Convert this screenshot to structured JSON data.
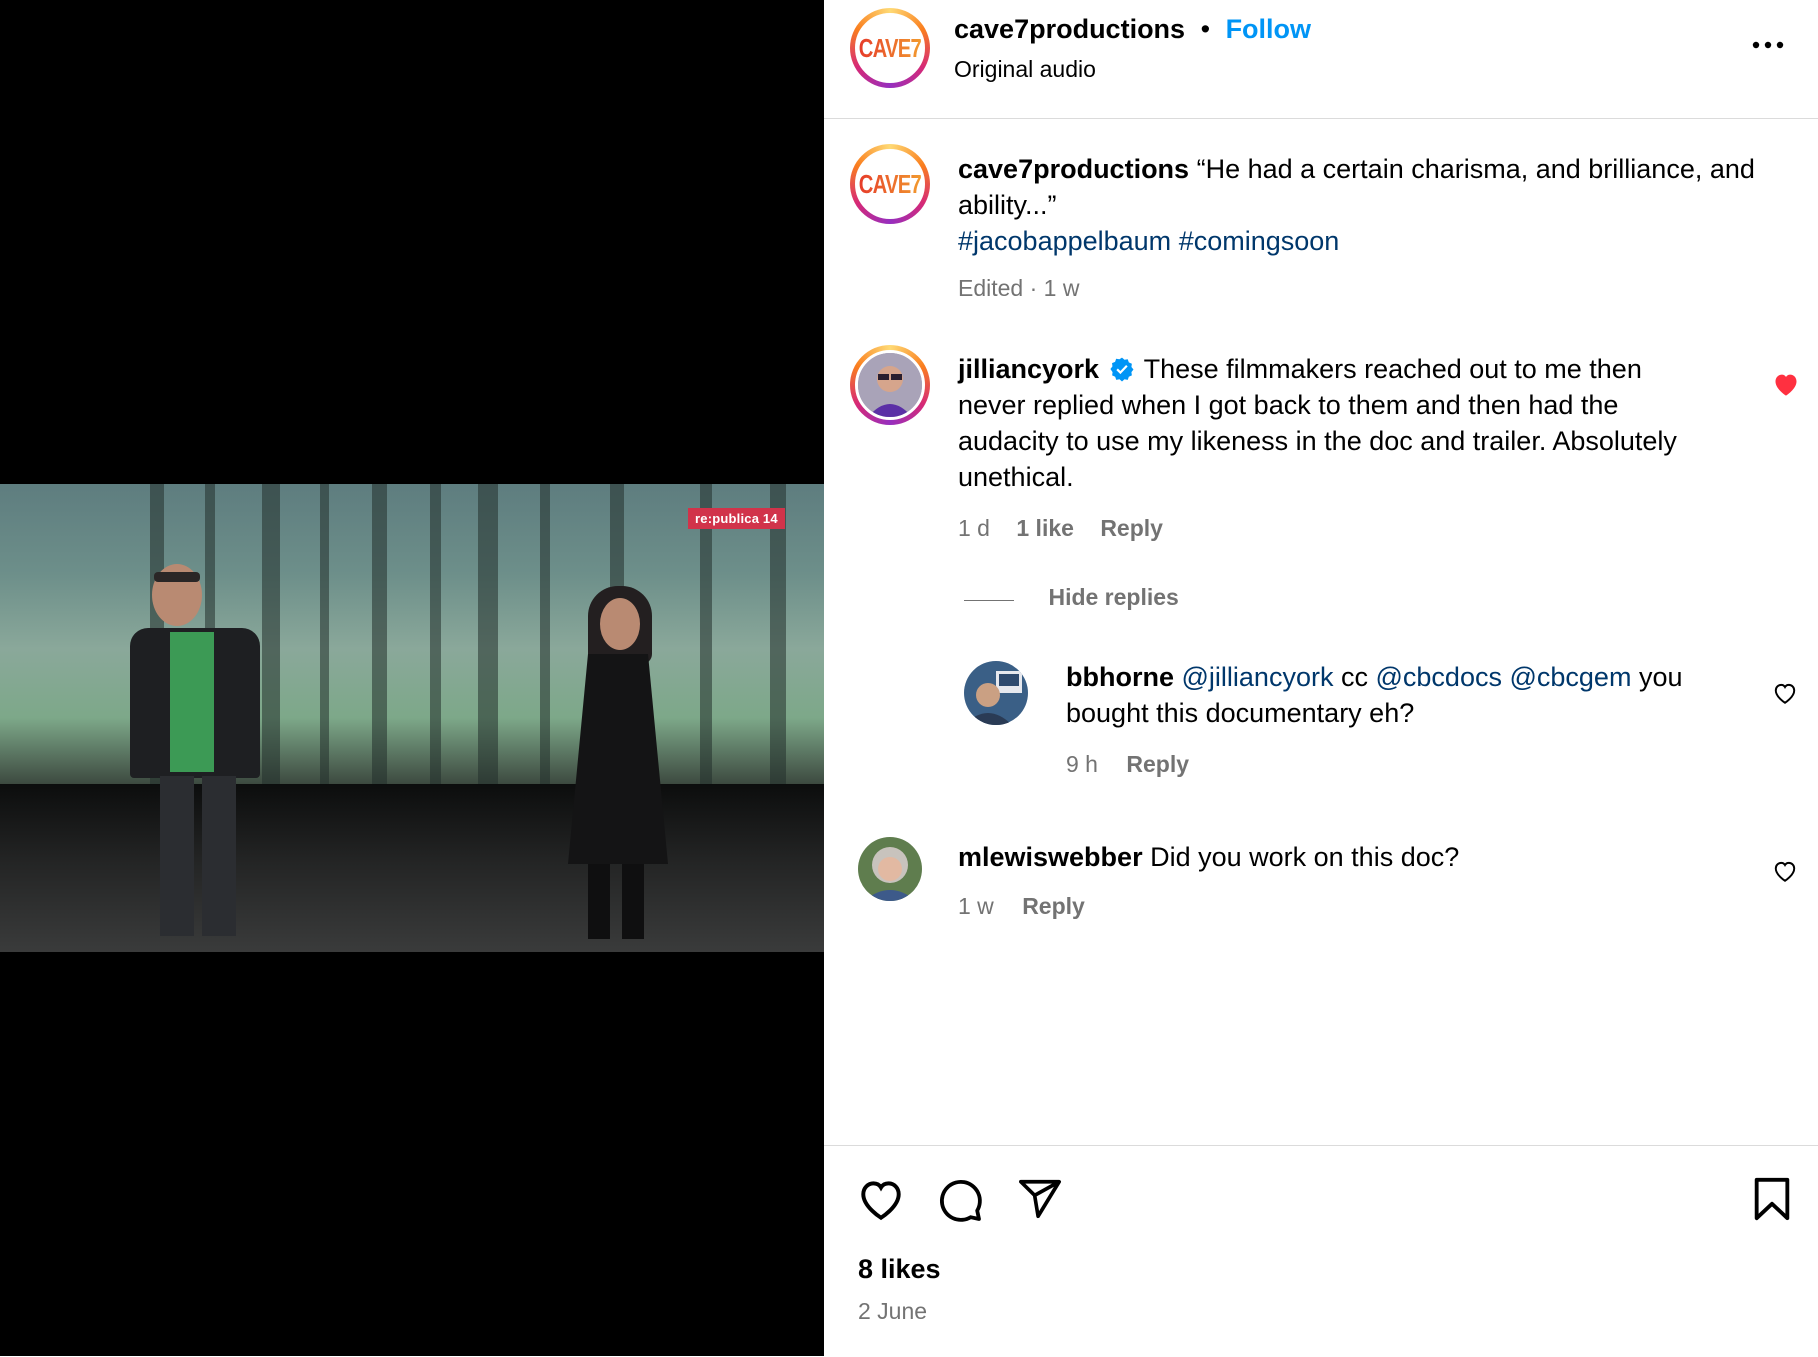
{
  "post": {
    "username": "cave7productions",
    "logo_text": "CAVE7",
    "separator": "•",
    "follow_label": "Follow",
    "audio": "Original audio"
  },
  "video": {
    "screen_logo": "re:publica 14"
  },
  "caption": {
    "username": "cave7productions",
    "text": "“He had a certain charisma, and brilliance, and ability...”",
    "hashtags": [
      "#jacobappelbaum",
      "#comingsoon"
    ],
    "meta": "Edited · 1 w"
  },
  "comments": [
    {
      "username": "jilliancyork",
      "verified": true,
      "text": "These filmmakers reached out to me then never replied when I got back to them and then had the audacity to use my likeness in the doc and trailer. Absolutely unethical.",
      "time": "1 d",
      "likes": "1 like",
      "reply_label": "Reply",
      "liked": true,
      "hide_replies_label": "Hide replies",
      "replies": [
        {
          "username": "bbhorne",
          "mention1": "@jilliancyork",
          "cc": "cc",
          "mention2": "@cbcdocs",
          "mention3": "@cbcgem",
          "text_after": "you bought this documentary eh?",
          "time": "9 h",
          "reply_label": "Reply"
        }
      ]
    },
    {
      "username": "mlewiswebber",
      "text": "Did you work on this doc?",
      "time": "1 w",
      "reply_label": "Reply"
    }
  ],
  "footer": {
    "likes": "8 likes",
    "date": "2 June"
  },
  "colors": {
    "link": "#0095f6",
    "hashtag": "#00376b",
    "heart": "#ff3040",
    "verified": "#0095f6"
  },
  "icons": [
    "more-icon",
    "verified-icon",
    "heart-icon",
    "comment-icon",
    "share-icon",
    "bookmark-icon"
  ]
}
